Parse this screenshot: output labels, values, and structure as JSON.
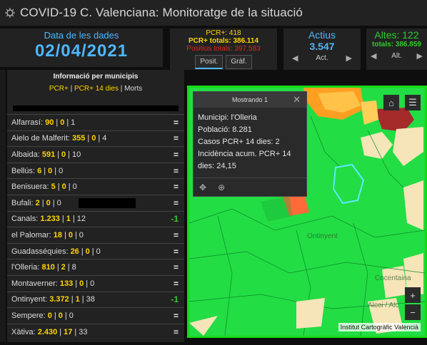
{
  "app": {
    "title": "COVID-19 C. Valenciana: Monitoratge de la situació",
    "logo_icon": "virus-logo-icon"
  },
  "date": {
    "label": "Data de les dades",
    "value": "02/04/2021"
  },
  "pcr": {
    "line1": "PCR+: 418",
    "line2": "PCR+ totals: 386.114",
    "line3": "Positius totals: 397.583",
    "tabs": [
      "Posit.",
      "Gràf."
    ]
  },
  "actius": {
    "label": "Actius",
    "value": "3.547",
    "nav": "Act."
  },
  "altes": {
    "label": "Altes: 122",
    "totals": "totals: 386.859",
    "nav": "Alt."
  },
  "municipis": {
    "title": "Informació per municipis",
    "legend": {
      "a": "PCR+",
      "sep1": " | ",
      "b": "PCR+ 14 dies",
      "sep2": " | ",
      "c": "Morts"
    },
    "rows": [
      {
        "name": "Alfarrasí:",
        "v1": "90",
        "v2": "0",
        "v3": "1",
        "trend": "="
      },
      {
        "name": "Aielo de Malferit:",
        "v1": "355",
        "v2": "0",
        "v3": "4",
        "trend": "="
      },
      {
        "name": "Albaida:",
        "v1": "591",
        "v2": "0",
        "v3": "10",
        "trend": "="
      },
      {
        "name": "Bellús:",
        "v1": "6",
        "v2": "0",
        "v3": "0",
        "trend": "="
      },
      {
        "name": "Benisuera:",
        "v1": "5",
        "v2": "0",
        "v3": "0",
        "trend": "="
      },
      {
        "name": "Bufali:",
        "v1": "2",
        "v2": "0",
        "v3": "0",
        "trend": "="
      },
      {
        "name": "Canals:",
        "v1": "1.233",
        "v2": "1",
        "v3": "12",
        "trend": "-1"
      },
      {
        "name": "el Palomar:",
        "v1": "18",
        "v2": "0",
        "v3": "0",
        "trend": "="
      },
      {
        "name": "Guadasséquies:",
        "v1": "26",
        "v2": "0",
        "v3": "0",
        "trend": "="
      },
      {
        "name": "l'Olleria:",
        "v1": "810",
        "v2": "2",
        "v3": "8",
        "trend": "="
      },
      {
        "name": "Montaverner:",
        "v1": "133",
        "v2": "0",
        "v3": "0",
        "trend": "="
      },
      {
        "name": "Ontinyent:",
        "v1": "3.372",
        "v2": "1",
        "v3": "38",
        "trend": "-1"
      },
      {
        "name": "Sempere:",
        "v1": "0",
        "v2": "0",
        "v3": "0",
        "trend": "="
      },
      {
        "name": "Xàtiva:",
        "v1": "2.430",
        "v2": "17",
        "v3": "33",
        "trend": "="
      }
    ]
  },
  "popup": {
    "header": "Mostrando 1",
    "lines": [
      "Municipi: l'Olleria",
      "Població: 8.281",
      "Casos PCR+ 14 dies: 2",
      "Incidència acum. PCR+ 14",
      "dies: 24,15"
    ]
  },
  "map": {
    "attribution": "Institut Cartogràfic Valencià",
    "labels": [
      "Ontinyent",
      "Cocentaina",
      "Alcoi / Alc"
    ],
    "zoom_in": "+",
    "zoom_out": "−"
  },
  "colors": {
    "accent_blue": "#4db7ff",
    "green": "#32c832",
    "yellow": "#ffd400",
    "red": "#e0261a",
    "map_green": "#22dd44"
  }
}
